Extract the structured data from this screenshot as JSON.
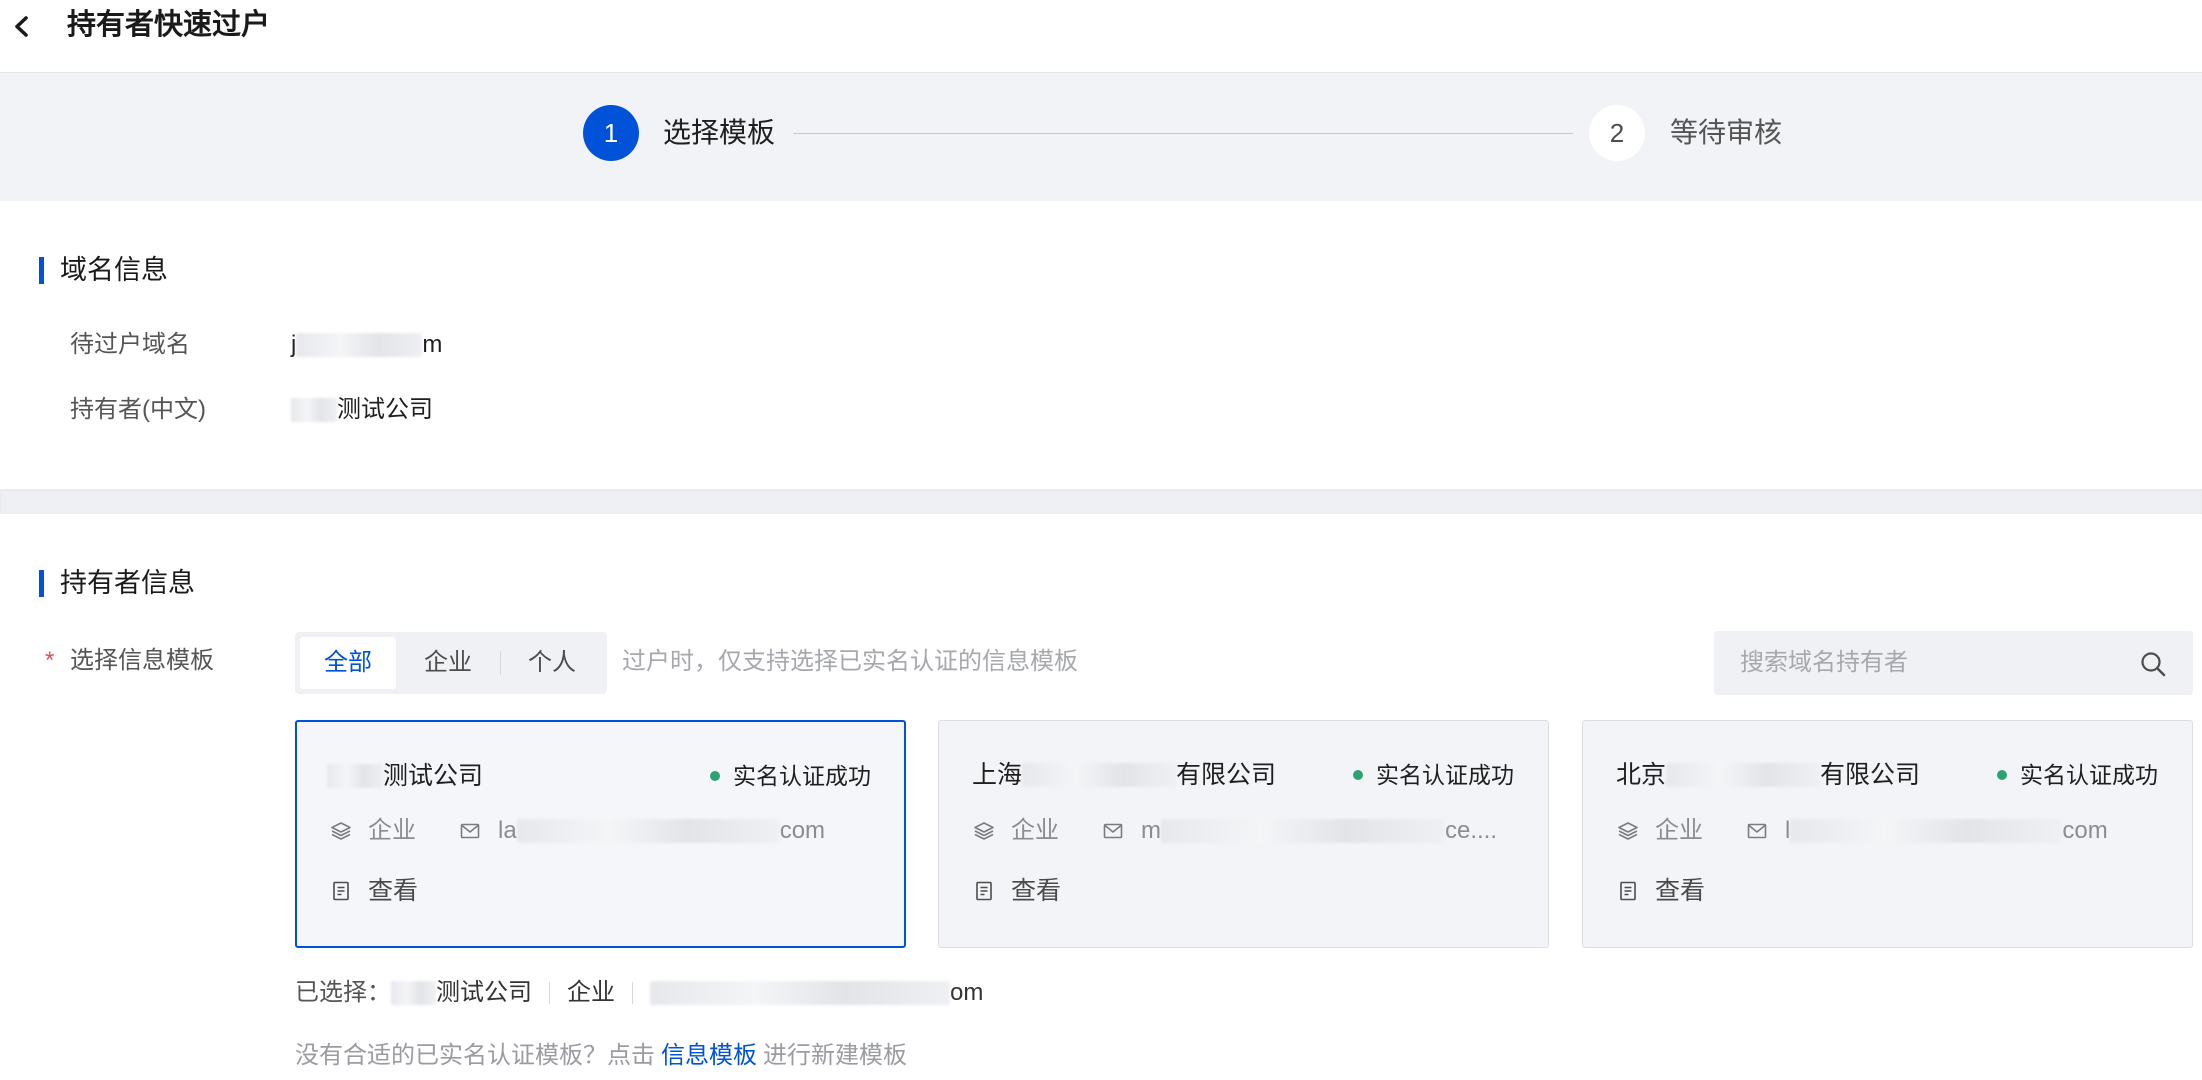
{
  "header": {
    "title": "持有者快速过户"
  },
  "steps": [
    {
      "index": "1",
      "label": "选择模板",
      "active": true
    },
    {
      "index": "2",
      "label": "等待审核",
      "active": false
    }
  ],
  "domain_info": {
    "heading": "域名信息",
    "rows": [
      {
        "label": "待过户域名",
        "value_prefix": "j",
        "value_suffix": "m"
      },
      {
        "label": "持有者(中文)",
        "value_suffix": "测试公司"
      }
    ]
  },
  "holder_info": {
    "heading": "持有者信息",
    "required_mark": "*",
    "field_label": "选择信息模板",
    "tabs": [
      {
        "label": "全部",
        "active": true
      },
      {
        "label": "企业",
        "active": false
      },
      {
        "label": "个人",
        "active": false
      }
    ],
    "hint": "过户时，仅支持选择已实名认证的信息模板",
    "search": {
      "placeholder": "搜索域名持有者"
    },
    "cards": [
      {
        "title_suffix": "测试公司",
        "status": "实名认证成功",
        "type": "企业",
        "email_prefix": "la",
        "email_suffix": "com",
        "view": "查看",
        "selected": true
      },
      {
        "title_prefix": "上海",
        "title_suffix": "有限公司",
        "status": "实名认证成功",
        "type": "企业",
        "email_prefix": "m",
        "email_suffix": "ce....",
        "view": "查看",
        "selected": false
      },
      {
        "title_prefix": "北京",
        "title_suffix": "有限公司",
        "status": "实名认证成功",
        "type": "企业",
        "email_prefix": "l",
        "email_suffix": "com",
        "view": "查看",
        "selected": false
      }
    ],
    "selected": {
      "label": "已选择：",
      "name_suffix": "测试公司",
      "type": "企业",
      "email_suffix": "om"
    },
    "footer": {
      "prefix": "没有合适的已实名认证模板？点击",
      "link": "信息模板",
      "suffix": "进行新建模板"
    }
  },
  "icons": {
    "back": "chevron-left-icon",
    "type": "layers-icon",
    "email": "mail-icon",
    "view": "document-icon",
    "search": "search-icon"
  },
  "colors": {
    "accent": "#0052d9",
    "success": "#2ba471",
    "required": "#e34d59",
    "band": "#f2f3f7"
  }
}
